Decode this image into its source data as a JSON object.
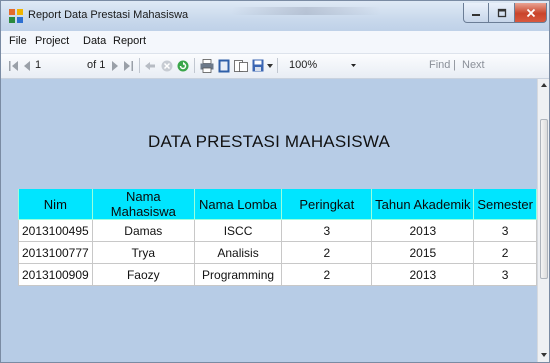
{
  "window": {
    "title": "Report Data Prestasi Mahasiswa",
    "colors": {
      "titlebar": "#c9d9ec",
      "close": "#c9442b"
    }
  },
  "menu": {
    "items": [
      "File",
      "Project",
      "Data",
      "Report"
    ]
  },
  "toolbar": {
    "page_current": "1",
    "page_of": "of 1",
    "zoom": "100%",
    "find": "Find",
    "divider": "|",
    "next": "Next",
    "icons": [
      "first-page-icon",
      "prev-page-icon",
      "next-page-icon",
      "last-page-icon",
      "back-icon",
      "stop-icon",
      "refresh-icon",
      "print-icon",
      "print-layout-icon",
      "page-setup-icon",
      "export-icon"
    ]
  },
  "report": {
    "title": "DATA PRESTASI MAHASISWA",
    "background": "#b7cce6",
    "header_color": "#00e5ff",
    "columns": [
      "Nim",
      "Nama Mahasiswa",
      "Nama Lomba",
      "Peringkat",
      "Tahun Akademik",
      "Semester"
    ],
    "rows": [
      [
        "2013100495",
        "Damas",
        "ISCC",
        "3",
        "2013",
        "3"
      ],
      [
        "2013100777",
        "Trya",
        "Analisis",
        "2",
        "2015",
        "2"
      ],
      [
        "2013100909",
        "Faozy",
        "Programming",
        "2",
        "2013",
        "3"
      ]
    ]
  }
}
